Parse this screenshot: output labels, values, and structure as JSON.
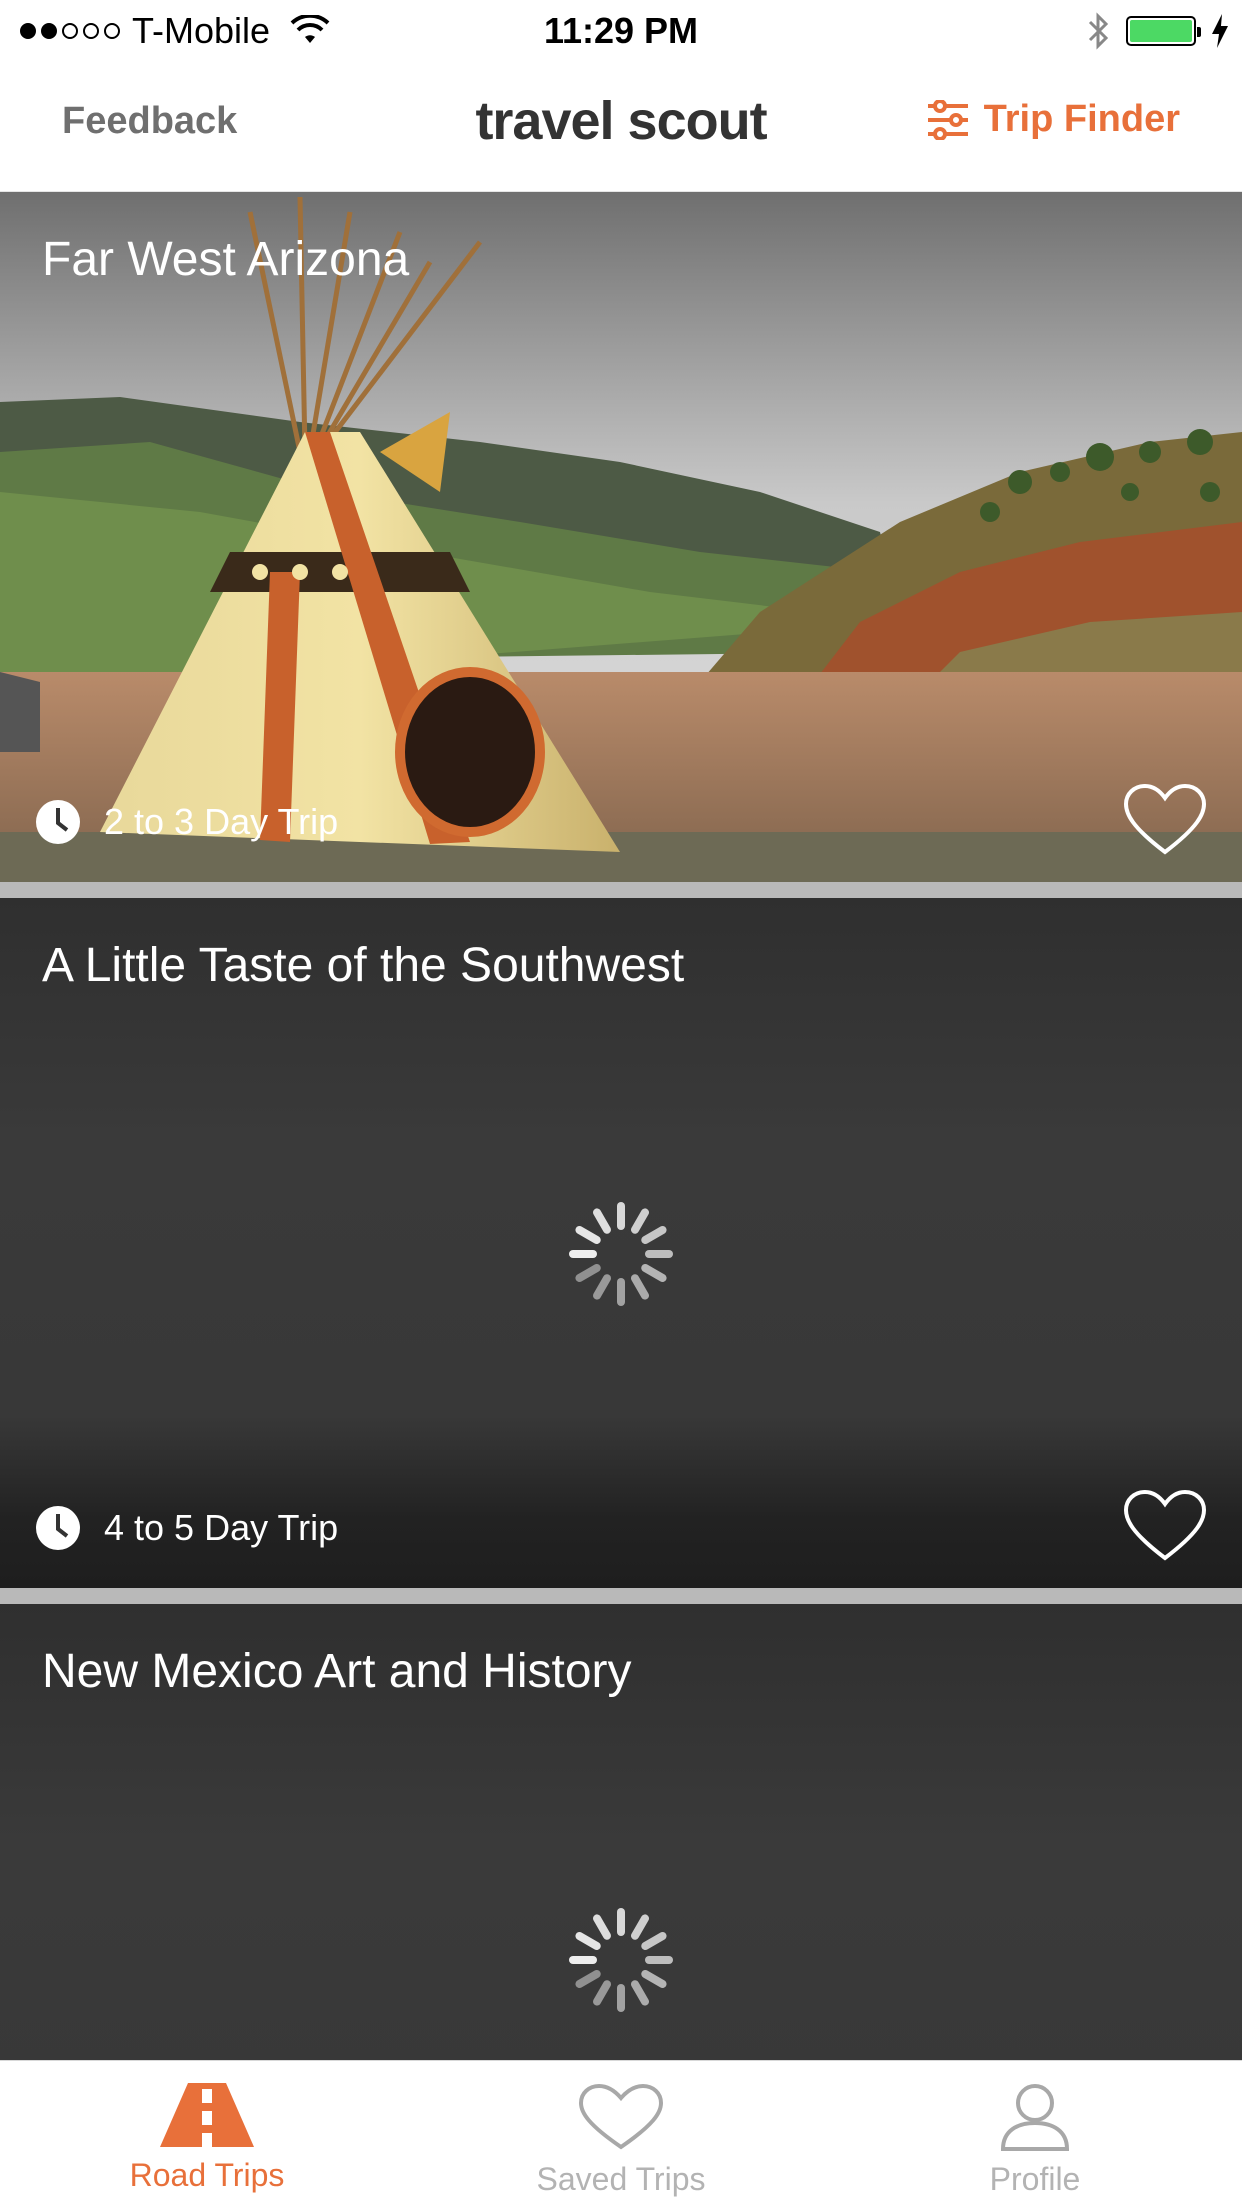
{
  "status_bar": {
    "carrier": "T-Mobile",
    "time": "11:29 PM",
    "signal_bars_filled": 2,
    "signal_bars_total": 5,
    "battery_level": 1.0
  },
  "nav": {
    "feedback_label": "Feedback",
    "brand": "travel scout",
    "trip_finder_label": "Trip Finder"
  },
  "trips": [
    {
      "title": "Far West Arizona",
      "duration": "2 to 3 Day Trip",
      "image": "tipi-in-canyon-photo",
      "loaded": true
    },
    {
      "title": "A Little Taste of the Southwest",
      "duration": "4 to 5 Day Trip",
      "loaded": false
    },
    {
      "title": "New Mexico Art and History",
      "loaded": false
    }
  ],
  "tabs": [
    {
      "label": "Road Trips",
      "icon": "road-icon",
      "active": true
    },
    {
      "label": "Saved Trips",
      "icon": "heart-icon",
      "active": false
    },
    {
      "label": "Profile",
      "icon": "person-icon",
      "active": false
    }
  ],
  "colors": {
    "accent": "#e8703a",
    "tab_inactive": "#b3b3b3",
    "card_background": "#383838",
    "battery": "#4cd964"
  }
}
